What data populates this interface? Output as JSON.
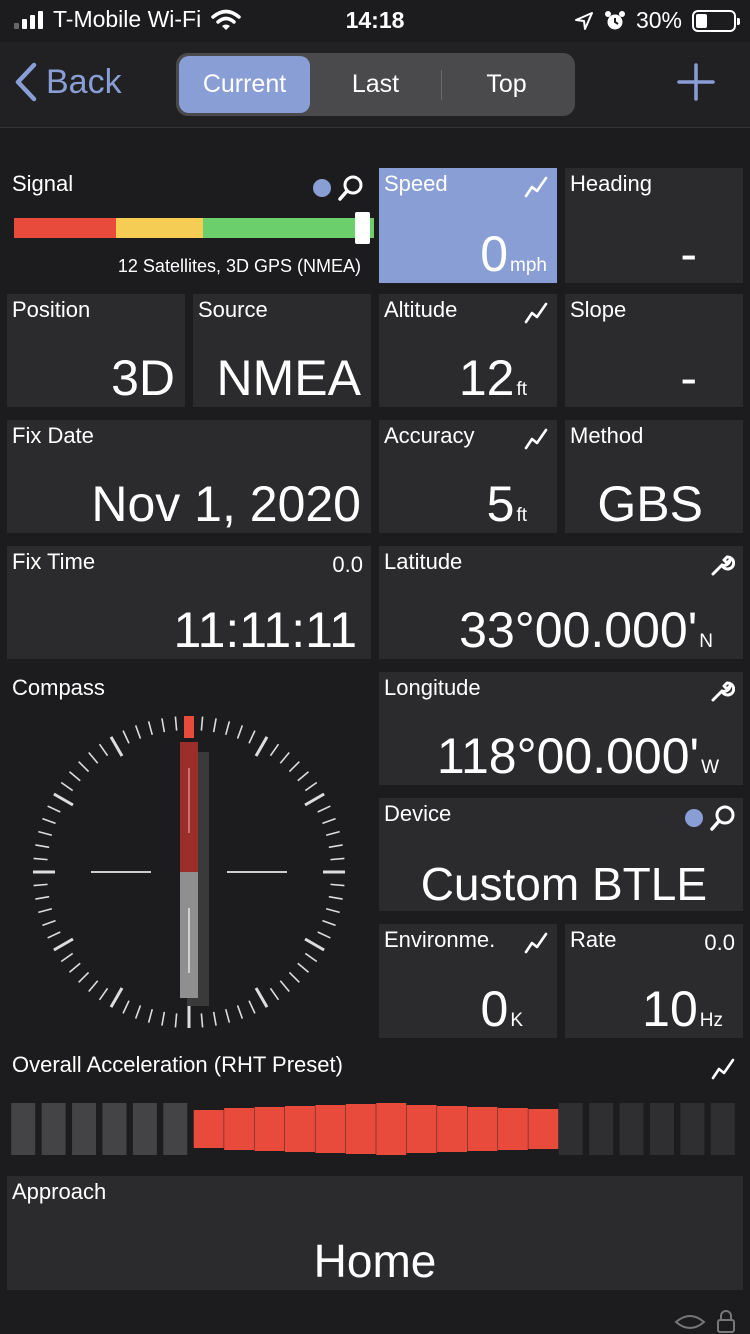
{
  "status_bar": {
    "carrier": "T-Mobile Wi-Fi",
    "time": "14:18",
    "battery_percent": "30%",
    "battery_level": 0.3
  },
  "nav": {
    "back_label": "Back",
    "segments": [
      "Current",
      "Last",
      "Top"
    ],
    "active_segment": "Current",
    "accent_color": "#8a9ed6"
  },
  "signal": {
    "label": "Signal",
    "status_text": "12 Satellites, 3D GPS (NMEA)",
    "level": 1.0,
    "segment_colors": [
      "#e84b3c",
      "#f5cd55",
      "#6bcf6b"
    ]
  },
  "tiles": {
    "speed": {
      "label": "Speed",
      "value": "0",
      "unit": "mph"
    },
    "heading": {
      "label": "Heading",
      "value": "-"
    },
    "position": {
      "label": "Position",
      "value": "3D"
    },
    "source": {
      "label": "Source",
      "value": "NMEA"
    },
    "altitude": {
      "label": "Altitude",
      "value": "12",
      "unit": "ft"
    },
    "slope": {
      "label": "Slope",
      "value": "-"
    },
    "fix_date": {
      "label": "Fix Date",
      "value": "Nov 1, 2020"
    },
    "accuracy": {
      "label": "Accuracy",
      "value": "5",
      "unit": "ft"
    },
    "method": {
      "label": "Method",
      "value": "GBS"
    },
    "fix_time": {
      "label": "Fix Time",
      "value": "11:11:11",
      "age": "0.0"
    },
    "latitude": {
      "label": "Latitude",
      "value": "33°00.000'",
      "hemisphere": "N"
    },
    "compass": {
      "label": "Compass"
    },
    "longitude": {
      "label": "Longitude",
      "value": "118°00.000'",
      "hemisphere": "W"
    },
    "device": {
      "label": "Device",
      "value": "Custom BTLE"
    },
    "environment": {
      "label": "Environme.",
      "value": "0",
      "unit": "K"
    },
    "rate": {
      "label": "Rate",
      "value": "10",
      "unit": "Hz",
      "age": "0.0"
    },
    "approach": {
      "label": "Approach",
      "value": "Home"
    }
  },
  "acceleration": {
    "label": "Overall Acceleration (RHT Preset)",
    "active_color": "#e84b3c"
  },
  "icons": [
    "signal-bars-icon",
    "wifi-icon",
    "location-arrow-icon",
    "alarm-icon",
    "battery-icon",
    "chevron-left-icon",
    "plus-icon",
    "search-icon",
    "graph-icon",
    "wrench-icon",
    "compass-icon",
    "lock-icon"
  ]
}
